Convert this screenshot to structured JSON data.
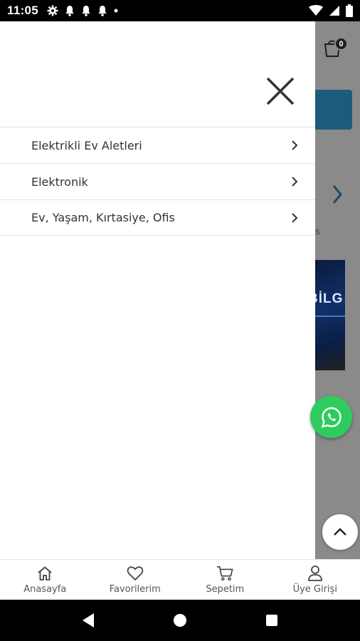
{
  "status_bar": {
    "time": "11:05",
    "left_icons": [
      "settings-icon",
      "notification-bell-icon",
      "notification-bell-icon",
      "notification-bell-icon",
      "dot-icon"
    ],
    "right_icons": [
      "wifi-icon",
      "signal-icon",
      "battery-icon"
    ]
  },
  "background_app": {
    "cart_badge_count": "0",
    "partial_text": "s",
    "banner_text": "BİLG"
  },
  "drawer": {
    "close_icon": "close-icon",
    "menu_items": [
      {
        "label": "Elektrikli Ev Aletleri"
      },
      {
        "label": "Elektronik"
      },
      {
        "label": "Ev, Yaşam, Kırtasiye, Ofis"
      }
    ]
  },
  "bottom_nav": {
    "items": [
      {
        "label": "Anasayfa",
        "icon": "home-icon"
      },
      {
        "label": "Favorilerim",
        "icon": "heart-icon"
      },
      {
        "label": "Sepetim",
        "icon": "cart-icon"
      },
      {
        "label": "Üye Girişi",
        "icon": "user-icon"
      }
    ]
  },
  "colors": {
    "whatsapp": "#2ecc5f",
    "accent_blue": "#1c5c7a",
    "overlay": "#8a8a8a"
  }
}
